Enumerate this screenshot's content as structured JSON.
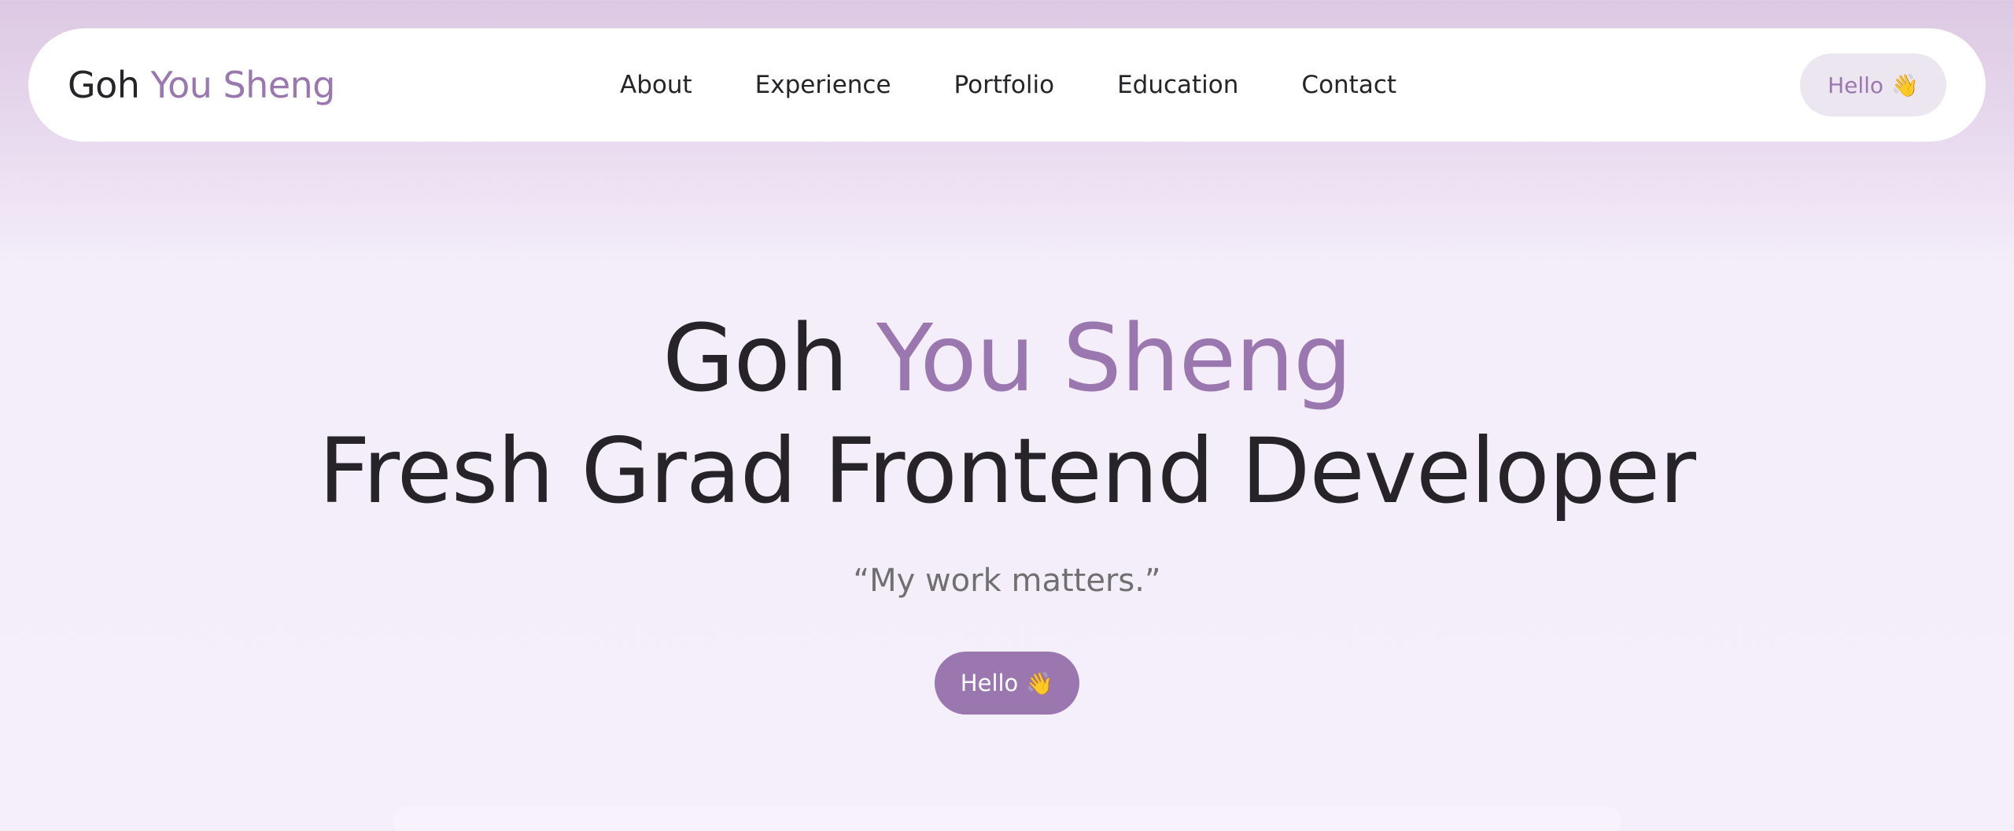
{
  "header": {
    "brand": {
      "first": "Goh",
      "accent": "You Sheng"
    },
    "nav": [
      "About",
      "Experience",
      "Portfolio",
      "Education",
      "Contact"
    ],
    "hello_button": {
      "label": "Hello",
      "emoji": "👋"
    }
  },
  "hero": {
    "name": {
      "first": "Goh",
      "accent": "You Sheng"
    },
    "role": "Fresh Grad Frontend Developer",
    "tagline": "“My work matters.”",
    "hello_button": {
      "label": "Hello",
      "emoji": "👋"
    }
  },
  "colors": {
    "accent": "#9b77b0",
    "text": "#262428",
    "muted": "#707070",
    "background": "#f5eefb",
    "pill_bg": "#ece6f1"
  }
}
